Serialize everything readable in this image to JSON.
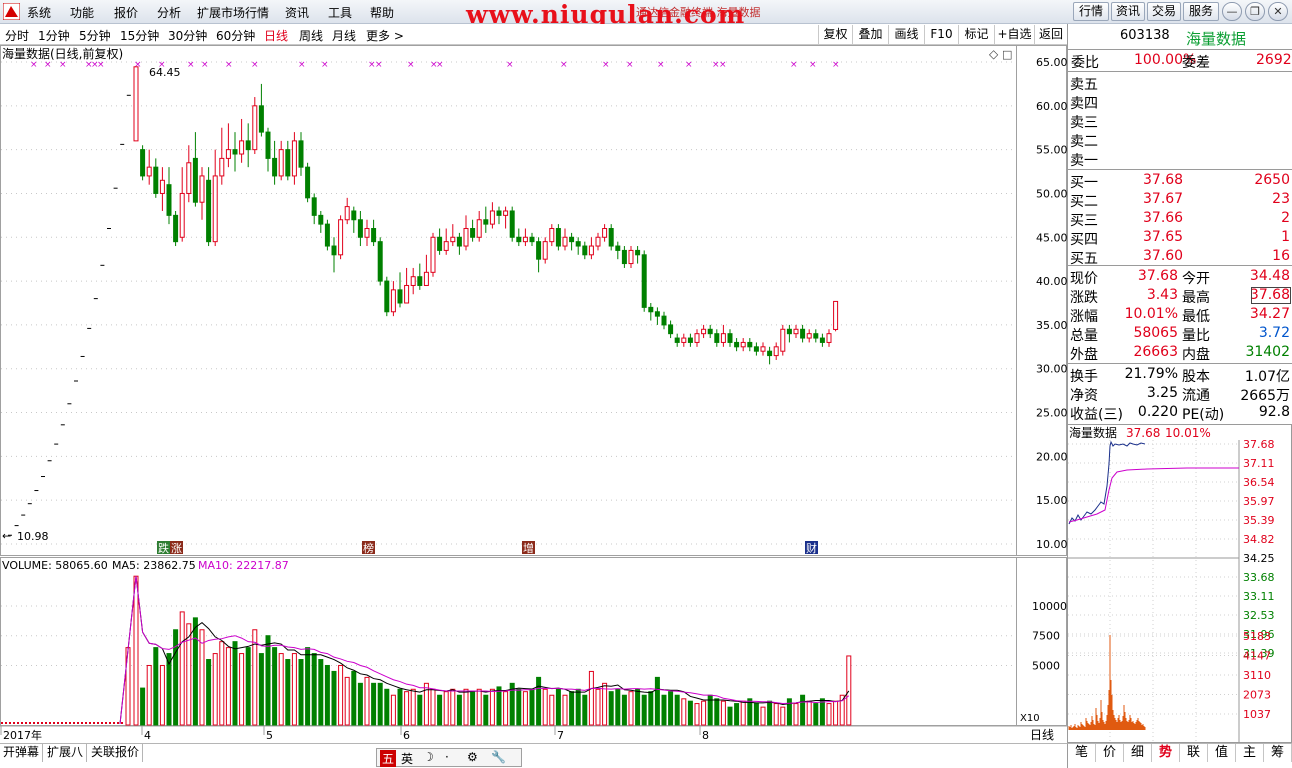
{
  "menu": {
    "items": [
      "系统",
      "功能",
      "报价",
      "分析",
      "扩展市场行情",
      "资讯",
      "工具",
      "帮助"
    ],
    "watermark": "www.niugulan.com",
    "window_title": "通达信金融终端   海量数据",
    "right_buttons": [
      "行情",
      "资讯",
      "交易",
      "服务"
    ]
  },
  "periods": {
    "items": [
      "分时",
      "1分钟",
      "5分钟",
      "15分钟",
      "30分钟",
      "60分钟",
      "日线",
      "周线",
      "月线",
      "更多 >"
    ],
    "active": "日线",
    "tools": [
      "复权",
      "叠加",
      "画线",
      "F10",
      "标记",
      "+自选",
      "返回"
    ]
  },
  "chart": {
    "title": "海量数据(日线,前复权)",
    "high_label": "64.45",
    "low_label": "10.98",
    "volume_label": "VOLUME: 58065.60",
    "ma5_label": "MA5: 23862.75",
    "ma10_label": "MA10: 22217.87",
    "scale_unit": "X10",
    "period_label": "日线",
    "event_tags": [
      {
        "text": "跌",
        "color": "#2e7d32"
      },
      {
        "text": "涨",
        "color": "#8b2a1a"
      },
      {
        "text": "榜",
        "color": "#8b2a1a"
      },
      {
        "text": "增",
        "color": "#8b2a1a"
      },
      {
        "text": "财",
        "color": "#1a2f8b"
      }
    ]
  },
  "chart_data": {
    "type": "candlestick",
    "title": "海量数据(日线,前复权)",
    "price_axis_ticks": [
      "65.00",
      "60.00",
      "55.00",
      "50.00",
      "45.00",
      "40.00",
      "35.00",
      "30.00",
      "25.00",
      "20.00",
      "15.00",
      "10.00"
    ],
    "price_range": [
      10,
      65.5
    ],
    "volume_axis_ticks": [
      "10000",
      "7500",
      "5000"
    ],
    "volume_unit": "X10",
    "x_tick_labels": [
      "2017年",
      "4",
      "5",
      "6",
      "7",
      "8"
    ],
    "limit_up_ladder": [
      11.0,
      12.1,
      13.3,
      14.6,
      16.1,
      17.7,
      19.5,
      21.4,
      23.6,
      26.0,
      28.6,
      31.4,
      34.6,
      38.0,
      41.8,
      46.0,
      50.6,
      55.6,
      61.2
    ],
    "candles": [
      [
        56.0,
        64.45,
        64.45,
        56.0,
        1
      ],
      [
        55.0,
        52.0,
        55.5,
        51.5,
        0
      ],
      [
        52.0,
        53.0,
        55.0,
        51.0,
        1
      ],
      [
        53.0,
        50.0,
        54.0,
        49.5,
        0
      ],
      [
        50.0,
        51.5,
        53.0,
        48.0,
        1
      ],
      [
        51.0,
        47.5,
        53.0,
        46.5,
        0
      ],
      [
        47.5,
        44.5,
        48.0,
        44.0,
        0
      ],
      [
        45.0,
        50.0,
        53.0,
        44.5,
        1
      ],
      [
        50.0,
        53.5,
        55.5,
        49.0,
        1
      ],
      [
        54.0,
        49.0,
        57.0,
        48.5,
        0
      ],
      [
        49.0,
        52.0,
        53.0,
        47.0,
        1
      ],
      [
        51.5,
        44.5,
        53.0,
        44.0,
        0
      ],
      [
        44.5,
        52.0,
        55.0,
        44.0,
        1
      ],
      [
        52.0,
        54.0,
        57.5,
        51.0,
        1
      ],
      [
        54.0,
        55.0,
        58.0,
        53.0,
        1
      ],
      [
        55.0,
        54.5,
        57.0,
        52.5,
        0
      ],
      [
        54.5,
        56.0,
        58.5,
        53.5,
        1
      ],
      [
        56.0,
        55.0,
        58.0,
        53.0,
        0
      ],
      [
        55.0,
        60.0,
        61.0,
        54.5,
        1
      ],
      [
        60.0,
        57.0,
        62.5,
        56.5,
        0
      ],
      [
        57.0,
        54.0,
        57.5,
        52.5,
        0
      ],
      [
        54.0,
        52.0,
        56.0,
        51.0,
        0
      ],
      [
        52.0,
        55.0,
        56.0,
        51.5,
        1
      ],
      [
        55.0,
        52.0,
        56.0,
        51.5,
        0
      ],
      [
        52.0,
        56.0,
        57.0,
        51.0,
        1
      ],
      [
        56.0,
        53.0,
        57.0,
        52.0,
        0
      ],
      [
        53.0,
        49.5,
        53.5,
        49.0,
        0
      ],
      [
        49.5,
        47.5,
        50.0,
        46.5,
        0
      ],
      [
        47.5,
        46.5,
        48.0,
        45.5,
        0
      ],
      [
        46.5,
        44.0,
        47.0,
        43.5,
        0
      ],
      [
        44.0,
        43.0,
        45.0,
        41.0,
        0
      ],
      [
        43.0,
        47.0,
        47.5,
        42.5,
        1
      ],
      [
        47.0,
        48.5,
        49.5,
        46.5,
        1
      ],
      [
        48.0,
        47.0,
        48.5,
        45.5,
        0
      ],
      [
        47.0,
        45.0,
        48.0,
        44.0,
        0
      ],
      [
        45.0,
        46.0,
        47.0,
        44.0,
        1
      ],
      [
        46.0,
        44.5,
        47.0,
        44.0,
        0
      ],
      [
        44.5,
        40.0,
        45.0,
        39.5,
        0
      ],
      [
        40.0,
        36.5,
        40.5,
        36.0,
        0
      ],
      [
        36.5,
        39.0,
        40.0,
        36.0,
        1
      ],
      [
        39.0,
        37.5,
        41.0,
        37.0,
        0
      ],
      [
        37.5,
        39.5,
        41.5,
        37.5,
        1
      ],
      [
        39.5,
        40.5,
        41.5,
        38.5,
        1
      ],
      [
        40.5,
        39.5,
        42.0,
        39.0,
        0
      ],
      [
        39.5,
        41.0,
        43.0,
        39.5,
        1
      ],
      [
        41.0,
        45.0,
        45.5,
        40.5,
        1
      ],
      [
        45.0,
        43.5,
        46.0,
        43.0,
        0
      ],
      [
        43.5,
        44.5,
        46.0,
        43.0,
        1
      ],
      [
        44.5,
        45.0,
        46.5,
        44.0,
        1
      ],
      [
        45.0,
        44.0,
        45.5,
        43.0,
        0
      ],
      [
        44.0,
        46.0,
        47.5,
        43.5,
        1
      ],
      [
        46.0,
        45.0,
        47.0,
        44.5,
        0
      ],
      [
        45.0,
        47.0,
        48.0,
        44.5,
        1
      ],
      [
        47.0,
        46.5,
        48.5,
        45.5,
        0
      ],
      [
        46.5,
        48.0,
        49.0,
        46.0,
        1
      ],
      [
        48.0,
        47.5,
        48.5,
        46.5,
        0
      ],
      [
        47.5,
        48.0,
        48.5,
        46.0,
        1
      ],
      [
        48.0,
        45.0,
        48.5,
        44.5,
        0
      ],
      [
        45.0,
        44.5,
        46.0,
        44.0,
        0
      ],
      [
        44.5,
        45.0,
        46.0,
        44.0,
        1
      ],
      [
        45.0,
        44.5,
        45.5,
        44.0,
        0
      ],
      [
        44.5,
        42.5,
        45.0,
        41.0,
        0
      ],
      [
        42.5,
        44.5,
        45.0,
        42.0,
        1
      ],
      [
        44.5,
        46.0,
        46.5,
        44.0,
        1
      ],
      [
        46.0,
        44.0,
        46.5,
        43.5,
        0
      ],
      [
        44.0,
        45.0,
        46.0,
        43.5,
        1
      ],
      [
        45.0,
        44.5,
        45.5,
        43.5,
        0
      ],
      [
        44.5,
        44.0,
        45.0,
        43.0,
        0
      ],
      [
        44.0,
        43.0,
        44.5,
        42.5,
        0
      ],
      [
        43.0,
        44.0,
        45.0,
        42.5,
        1
      ],
      [
        44.0,
        45.0,
        45.5,
        43.5,
        1
      ],
      [
        45.0,
        46.0,
        46.5,
        44.5,
        1
      ],
      [
        46.0,
        44.0,
        46.5,
        43.5,
        0
      ],
      [
        44.0,
        43.5,
        44.5,
        42.5,
        0
      ],
      [
        43.5,
        42.0,
        44.0,
        41.5,
        0
      ],
      [
        42.0,
        43.5,
        44.0,
        41.5,
        1
      ],
      [
        43.5,
        43.0,
        44.0,
        42.0,
        0
      ],
      [
        43.0,
        37.0,
        43.5,
        36.5,
        0
      ],
      [
        37.0,
        36.5,
        37.5,
        35.5,
        0
      ],
      [
        36.5,
        36.0,
        37.0,
        35.0,
        0
      ],
      [
        36.0,
        35.0,
        36.5,
        34.5,
        0
      ],
      [
        35.0,
        34.0,
        35.5,
        33.5,
        0
      ],
      [
        33.5,
        33.0,
        34.0,
        32.5,
        0
      ],
      [
        33.0,
        33.5,
        34.0,
        32.5,
        1
      ],
      [
        33.5,
        33.0,
        34.0,
        32.5,
        0
      ],
      [
        33.0,
        34.0,
        34.5,
        32.5,
        1
      ],
      [
        34.0,
        34.5,
        35.0,
        33.5,
        1
      ],
      [
        34.5,
        34.0,
        35.0,
        33.5,
        0
      ],
      [
        34.0,
        33.0,
        34.5,
        32.5,
        0
      ],
      [
        33.0,
        34.0,
        35.0,
        32.5,
        1
      ],
      [
        34.0,
        33.0,
        34.5,
        32.5,
        0
      ],
      [
        33.0,
        32.5,
        33.5,
        32.0,
        0
      ],
      [
        32.5,
        33.0,
        33.5,
        32.0,
        1
      ],
      [
        33.0,
        32.5,
        33.5,
        32.0,
        0
      ],
      [
        32.5,
        32.0,
        33.0,
        31.5,
        0
      ],
      [
        32.0,
        32.5,
        33.0,
        31.5,
        1
      ],
      [
        32.0,
        31.5,
        32.5,
        30.5,
        0
      ],
      [
        31.5,
        32.5,
        33.0,
        31.0,
        1
      ],
      [
        32.0,
        34.5,
        35.0,
        31.5,
        1
      ],
      [
        34.5,
        34.0,
        35.0,
        33.0,
        0
      ],
      [
        34.0,
        34.5,
        35.0,
        33.5,
        1
      ],
      [
        34.5,
        33.5,
        35.0,
        33.0,
        0
      ],
      [
        33.5,
        34.0,
        34.5,
        33.0,
        1
      ],
      [
        34.0,
        33.5,
        34.5,
        33.0,
        0
      ],
      [
        33.5,
        33.0,
        34.0,
        32.5,
        0
      ],
      [
        33.0,
        34.0,
        34.5,
        32.5,
        1
      ],
      [
        34.48,
        37.68,
        37.68,
        34.27,
        1
      ]
    ],
    "volumes": [
      12500,
      3100,
      5000,
      6500,
      5000,
      6000,
      8000,
      9500,
      8500,
      9000,
      8000,
      5500,
      6000,
      7000,
      6500,
      7000,
      6000,
      6500,
      8000,
      6000,
      7500,
      6500,
      6000,
      5500,
      6000,
      5500,
      6500,
      6000,
      5500,
      5000,
      4500,
      5000,
      4000,
      4500,
      3500,
      4000,
      3500,
      3500,
      3000,
      2500,
      3000,
      2800,
      3000,
      2500,
      3500,
      3000,
      2500,
      2800,
      3000,
      2500,
      3000,
      2800,
      3000,
      2500,
      3000,
      3200,
      2800,
      3500,
      3000,
      2800,
      3000,
      4000,
      3000,
      2500,
      3000,
      2500,
      2800,
      3000,
      2500,
      4500,
      3000,
      3500,
      2800,
      3000,
      2500,
      2800,
      3000,
      2500,
      2800,
      4000,
      2500,
      2800,
      2500,
      2200,
      2000,
      1800,
      2000,
      2500,
      2200,
      2000,
      1500,
      1800,
      2000,
      2200,
      1800,
      1500,
      2000,
      1800,
      1500,
      2200,
      1800,
      2500,
      2000,
      1800,
      2200,
      1800,
      2000,
      2500,
      5800
    ],
    "ma5_label": "MA5: 23862.75",
    "ma10_label": "MA10: 22217.87"
  },
  "quote": {
    "code": "603138",
    "name": "海量数据",
    "weibi_label": "委比",
    "weibi_value": "100.00%",
    "weicha_label": "委差",
    "weicha_value": "2692",
    "sells": [
      "卖五",
      "卖四",
      "卖三",
      "卖二",
      "卖一"
    ],
    "buys": [
      {
        "label": "买一",
        "price": "37.68",
        "vol": "2650"
      },
      {
        "label": "买二",
        "price": "37.67",
        "vol": "23"
      },
      {
        "label": "买三",
        "price": "37.66",
        "vol": "2"
      },
      {
        "label": "买四",
        "price": "37.65",
        "vol": "1"
      },
      {
        "label": "买五",
        "price": "37.60",
        "vol": "16"
      }
    ],
    "stats": [
      {
        "l1": "现价",
        "v1": "37.68",
        "c1": "red",
        "l2": "今开",
        "v2": "34.48",
        "c2": "red"
      },
      {
        "l1": "涨跌",
        "v1": "3.43",
        "c1": "red",
        "l2": "最高",
        "v2": "37.68",
        "c2": "red"
      },
      {
        "l1": "涨幅",
        "v1": "10.01%",
        "c1": "red",
        "l2": "最低",
        "v2": "34.27",
        "c2": "red"
      },
      {
        "l1": "总量",
        "v1": "58065",
        "c1": "red",
        "l2": "量比",
        "v2": "3.72",
        "c2": "blue"
      },
      {
        "l1": "外盘",
        "v1": "26663",
        "c1": "red",
        "l2": "内盘",
        "v2": "31402",
        "c2": "green"
      }
    ],
    "fund": [
      {
        "l1": "换手",
        "v1": "21.79%",
        "l2": "股本",
        "v2": "1.07亿"
      },
      {
        "l1": "净资",
        "v1": "3.25",
        "l2": "流通",
        "v2": "2665万"
      },
      {
        "l1": "收益(三)",
        "v1": "0.220",
        "l2": "PE(动)",
        "v2": "92.8"
      }
    ]
  },
  "intraday": {
    "title": "海量数据",
    "price": "37.68",
    "pct": "10.01%",
    "price_ticks": [
      "37.68",
      "37.11",
      "36.54",
      "35.97",
      "35.39",
      "34.82",
      "34.25",
      "33.68",
      "33.11",
      "32.53",
      "31.96",
      "31.39"
    ],
    "volume_ticks": [
      "5183",
      "4147",
      "3110",
      "2073",
      "1037"
    ]
  },
  "bottom_tabs": [
    "开弹幕",
    "扩展八",
    "关联报价"
  ],
  "right_tabs": [
    "笔",
    "价",
    "细",
    "势",
    "联",
    "值",
    "主",
    "筹"
  ],
  "right_tab_active": "势",
  "ime": {
    "items": [
      "五",
      "英",
      "☽",
      "·",
      "⚙",
      "🔧"
    ]
  },
  "colors": {
    "up": "#e0001b",
    "down": "#008000",
    "ma5": "#000000",
    "ma10": "#cc00cc",
    "intraday_price": "#1a2f8b",
    "avg": "#cc00cc"
  }
}
